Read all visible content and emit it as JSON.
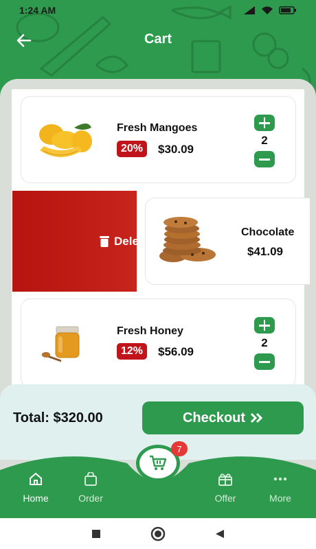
{
  "status_bar": {
    "time": "1:24 AM",
    "battery": "75"
  },
  "header": {
    "title": "Cart"
  },
  "cart_items": [
    {
      "name": "Fresh Mangoes",
      "discount": "20%",
      "price": "$30.09",
      "quantity": "2"
    },
    {
      "name": "Chocolate",
      "price": "$41.09"
    },
    {
      "name": "Fresh Honey",
      "discount": "12%",
      "price": "$56.09",
      "quantity": "2"
    }
  ],
  "swipe_action": {
    "label": "Dele"
  },
  "summary": {
    "total_label": "Total: $320.00",
    "checkout_label": "Checkout"
  },
  "bottom_nav": {
    "items": [
      {
        "label": "Home",
        "icon": "home-icon",
        "active": true
      },
      {
        "label": "Order",
        "icon": "bag-icon",
        "active": false
      },
      {
        "label": "Offer",
        "icon": "gift-icon",
        "active": false
      },
      {
        "label": "More",
        "icon": "more-icon",
        "active": false
      }
    ],
    "cart_badge": "7"
  },
  "colors": {
    "primary": "#2e9a4e",
    "discount": "#c0141a",
    "delete": "#b7130f"
  }
}
